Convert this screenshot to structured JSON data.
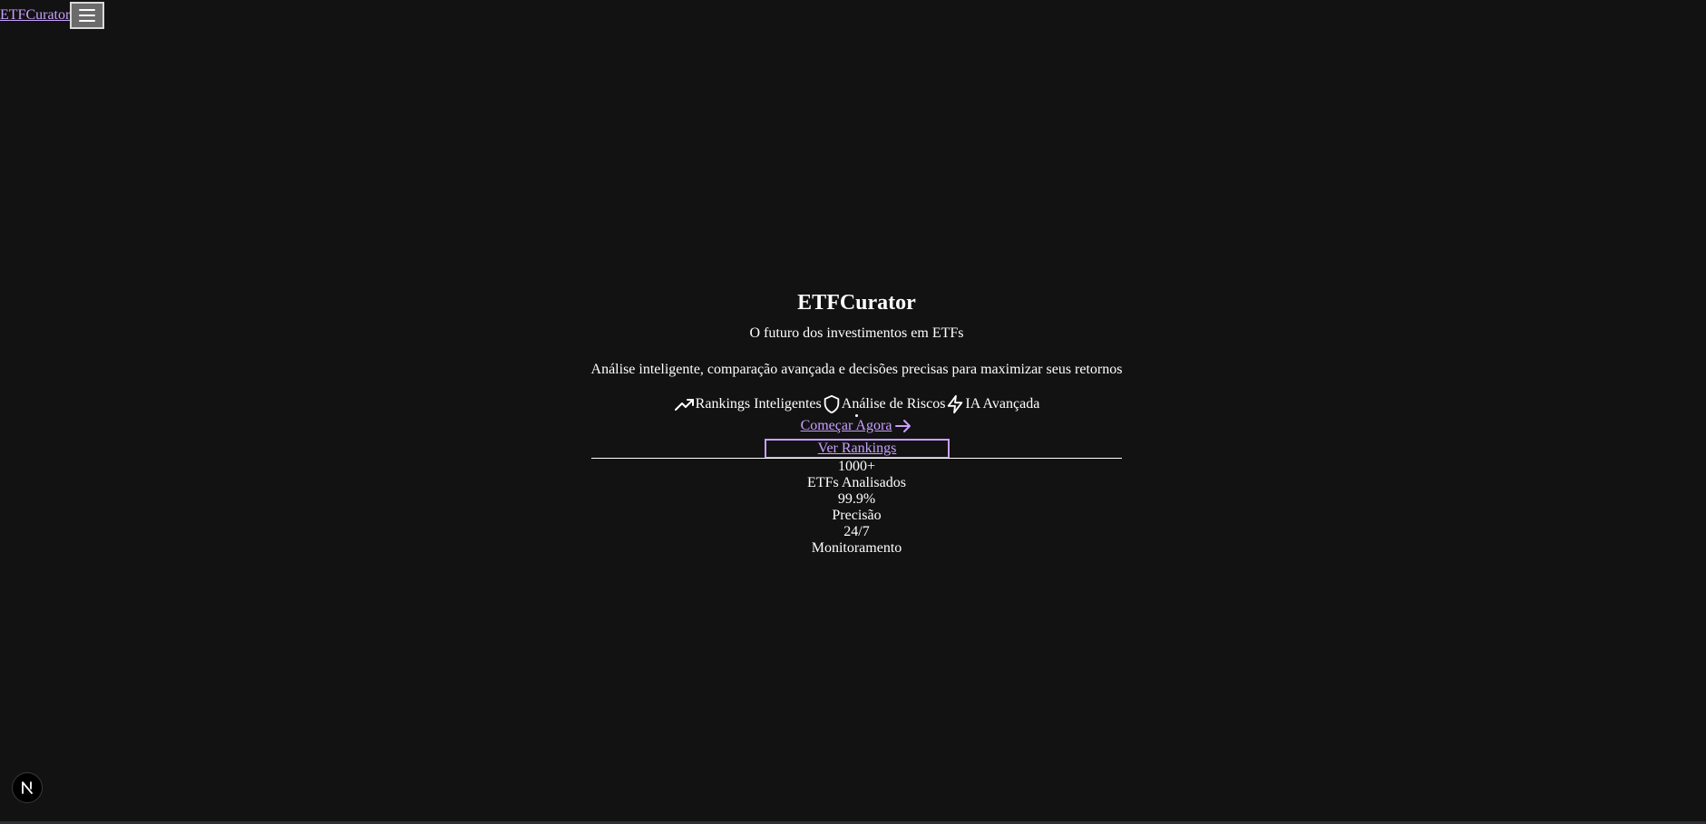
{
  "header": {
    "brand": "ETFCurator",
    "menu_icon": "hamburger-menu-icon"
  },
  "hero": {
    "title": "ETFCurator",
    "tagline": "O futuro dos investimentos em ETFs",
    "description": "Análise inteligente, comparação avançada e decisões precisas para maximizar seus retornos",
    "features": [
      {
        "icon": "trending-up-icon",
        "label": "Rankings Inteligentes"
      },
      {
        "icon": "shield-icon",
        "label": "Análise de Riscos"
      },
      {
        "icon": "lightning-icon",
        "label": "IA Avançada"
      }
    ],
    "primary_cta": "Começar Agora",
    "secondary_cta": "Ver Rankings"
  },
  "stats": [
    {
      "value": "1000+",
      "label": "ETFs Analisados"
    },
    {
      "value": "99.9%",
      "label": "Precisão"
    },
    {
      "value": "24/7",
      "label": "Monitoramento"
    }
  ],
  "dev_badge": {
    "icon": "nextjs-logo-icon"
  },
  "colors": {
    "background": "#121212",
    "link": "#c9a0ff",
    "text": "#ffffff"
  }
}
